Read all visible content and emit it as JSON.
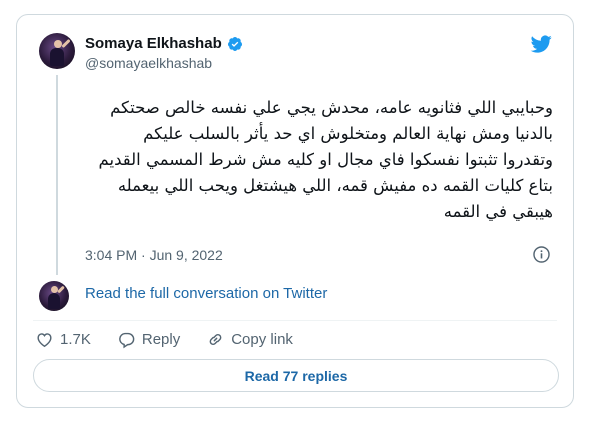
{
  "colors": {
    "link": "#1d68a7",
    "twitter_blue": "#1d9bf0",
    "secondary_text": "#536471",
    "border": "#cfd9de"
  },
  "author": {
    "display_name": "Somaya Elkhashab",
    "handle": "@somayaelkhashab",
    "verified": true
  },
  "tweet": {
    "text": "وحبايبي اللي فثانويه عامه، محدش يجي علي نفسه خالص صحتكم بالدنيا ومش نهاية العالم ومتخلوش اي حد يأثر بالسلب عليكم وتقدروا تثبتوا نفسكوا فاي مجال او كليه مش شرط المسمي القديم بتاع كليات القمه ده مفيش قمه، اللي هيشتغل ويحب اللي بيعمله هيبقي في القمه",
    "timestamp": "3:04 PM · Jun 9, 2022"
  },
  "thread": {
    "read_conversation_label": "Read the full conversation on Twitter"
  },
  "actions": {
    "likes_count": "1.7K",
    "reply_label": "Reply",
    "copy_link_label": "Copy link"
  },
  "footer": {
    "read_replies_label": "Read 77 replies"
  },
  "icons": [
    "verified-badge-icon",
    "twitter-bird-icon",
    "info-icon",
    "heart-icon",
    "reply-bubble-icon",
    "link-icon"
  ]
}
